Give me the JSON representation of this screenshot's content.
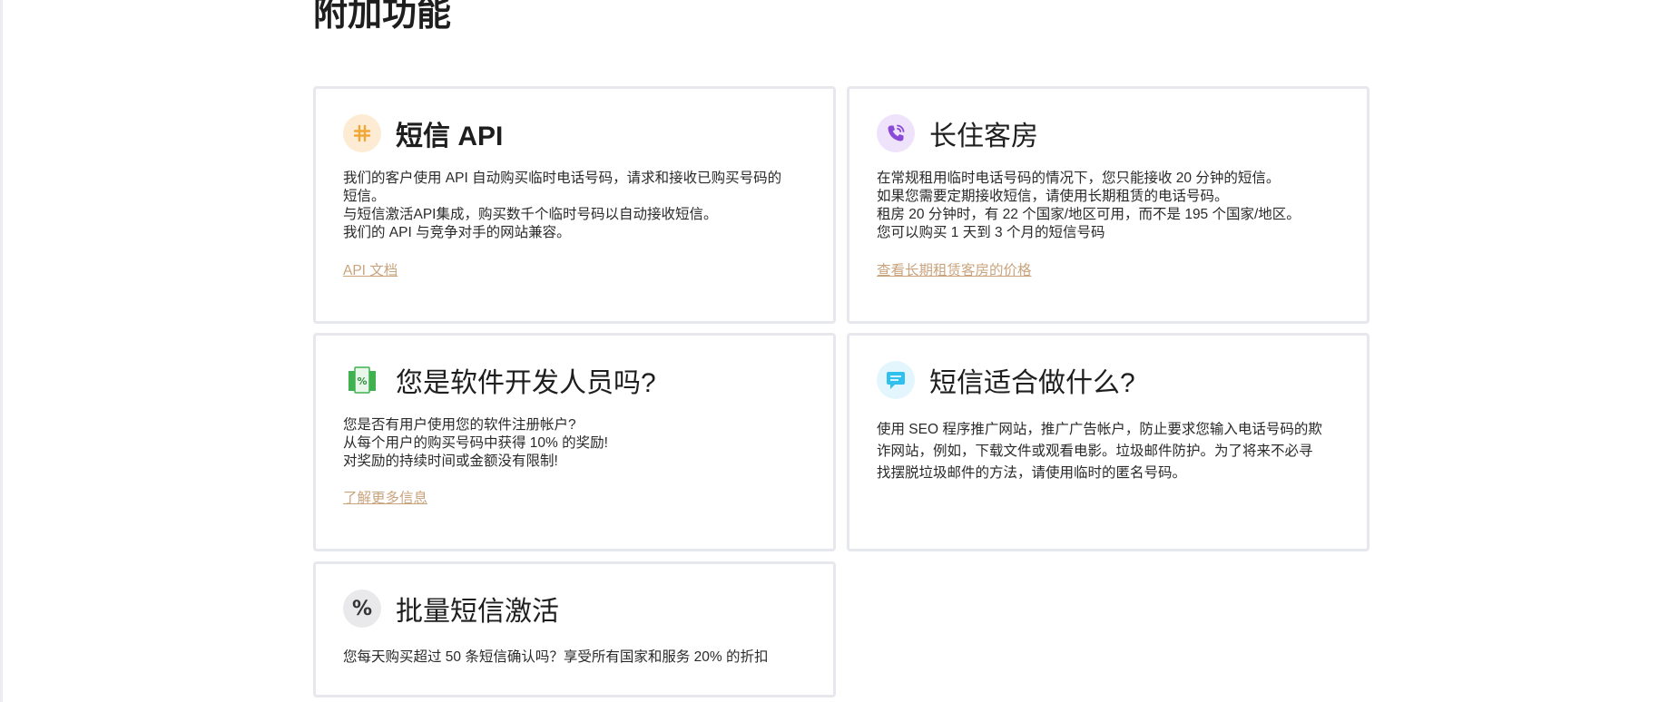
{
  "section": {
    "title": "附加功能"
  },
  "cards": {
    "sms_api": {
      "title": "短信 API",
      "icon": "hash-icon",
      "lines": [
        "我们的客户使用 API 自动购买临时电话号码，请求和接收已购买号码的",
        "短信。",
        "与短信激活API集成，购买数千个临时号码以自动接收短信。",
        "我们的 API 与竞争对手的网站兼容。"
      ],
      "link": "API 文档"
    },
    "long_term": {
      "title": "长住客房",
      "icon": "phone-call-icon",
      "lines": [
        "在常规租用临时电话号码的情况下，您只能接收 20 分钟的短信。",
        "如果您需要定期接收短信，请使用长期租赁的电话号码。",
        "租房 20 分钟时，有 22 个国家/地区可用，而不是 195 个国家/地区。",
        "您可以购买 1 天到 3 个月的短信号码"
      ],
      "link": "查看长期租赁客房的价格"
    },
    "developer": {
      "title": "您是软件开发人员吗?",
      "icon": "discount-tag-icon",
      "lines": [
        "您是否有用户使用您的软件注册帐户?",
        "从每个用户的购买号码中获得 10% 的奖励!",
        "对奖励的持续时间或金额没有限制!"
      ],
      "link": "了解更多信息"
    },
    "use_cases": {
      "title": "短信适合做什么?",
      "icon": "chat-bubble-icon",
      "lines": [
        "使用 SEO 程序推广网站，推广广告帐户，防止要求您输入电话号码的欺",
        "诈网站，例如，下载文件或观看电影。垃圾邮件防护。为了将来不必寻",
        "找摆脱垃圾邮件的方法，请使用临时的匿名号码。"
      ]
    },
    "bulk": {
      "title": "批量短信激活",
      "icon": "percent-icon",
      "icon_glyph": "%",
      "lines": [
        "您每天购买超过 50 条短信确认吗？享受所有国家和服务 20% 的折扣"
      ]
    }
  },
  "colors": {
    "link": "#c9a47e",
    "card_border": "#e7e8ee",
    "hash_icon_bg": "#fdecd3",
    "hash_icon_fg": "#f2a634",
    "phone_icon_bg": "#efe2fb",
    "phone_icon_fg": "#8a4ad8",
    "tag_icon_fg": "#3fb24f",
    "chat_icon_bg": "#e3f6fd",
    "chat_icon_fg": "#2fc0ee",
    "percent_icon_bg": "#e9e9ec"
  }
}
